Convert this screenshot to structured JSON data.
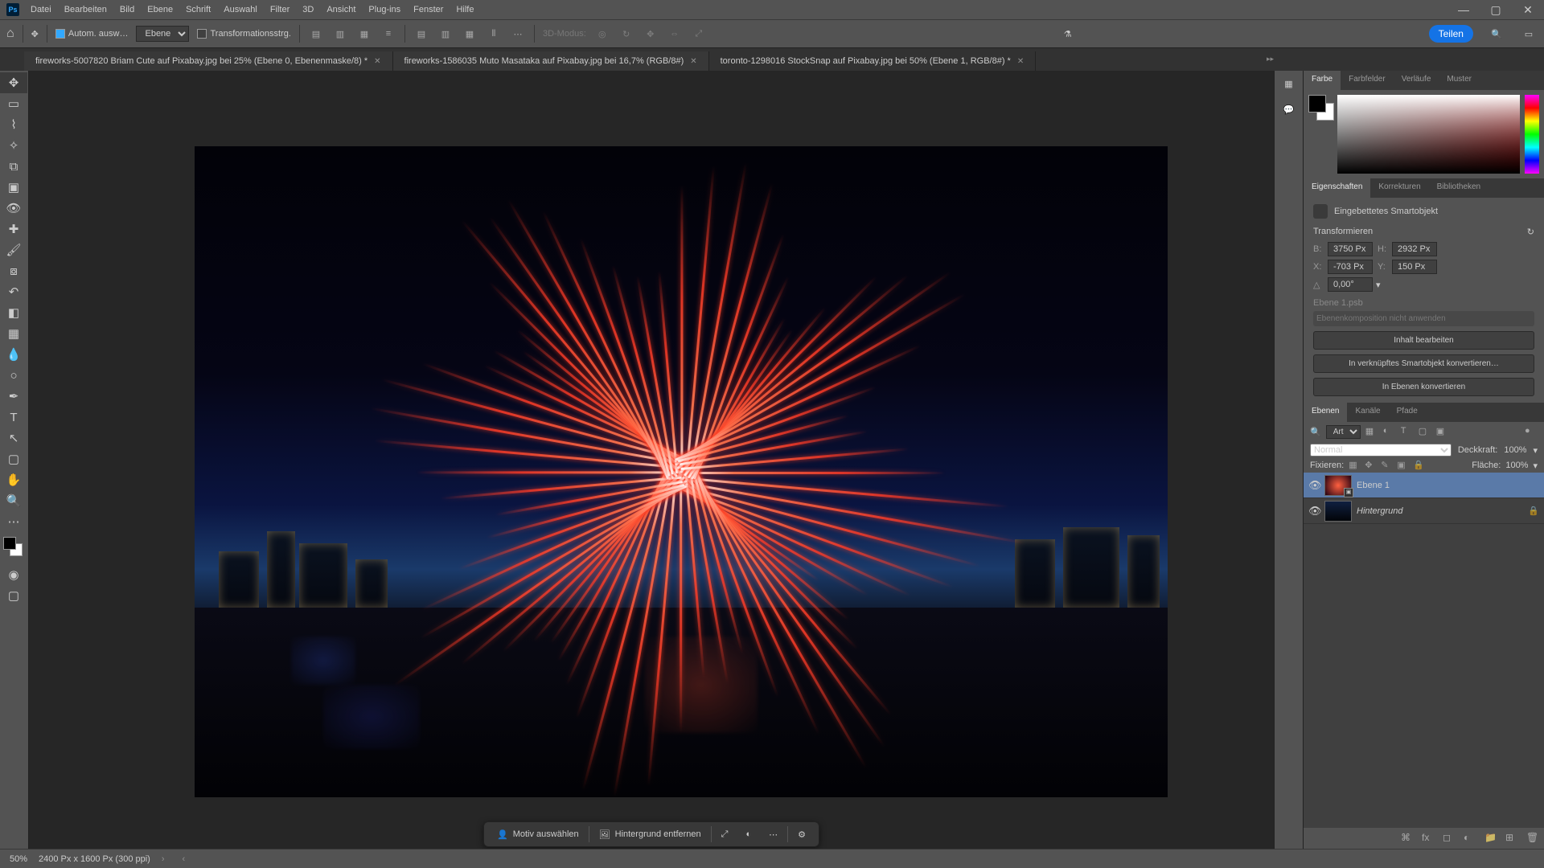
{
  "menu": {
    "items": [
      "Datei",
      "Bearbeiten",
      "Bild",
      "Ebene",
      "Schrift",
      "Auswahl",
      "Filter",
      "3D",
      "Ansicht",
      "Plug-ins",
      "Fenster",
      "Hilfe"
    ]
  },
  "optbar": {
    "auto_select": "Autom. ausw…",
    "layer_select": "Ebene",
    "transform_ctrl": "Transformationsstrg.",
    "mode3d": "3D-Modus:",
    "share": "Teilen"
  },
  "tabs": [
    {
      "label": "fireworks-5007820 Briam Cute auf Pixabay.jpg bei 25% (Ebene 0, Ebenenmaske/8) *",
      "active": false
    },
    {
      "label": "fireworks-1586035 Muto Masataka auf Pixabay.jpg bei 16,7% (RGB/8#)",
      "active": false
    },
    {
      "label": "toronto-1298016 StockSnap auf Pixabay.jpg bei 50% (Ebene 1, RGB/8#) *",
      "active": true
    }
  ],
  "tools": [
    "move",
    "rect-marquee",
    "lasso",
    "wand",
    "crop",
    "frame",
    "eyedropper",
    "healing",
    "brush",
    "stamp",
    "history-brush",
    "eraser",
    "gradient",
    "blur",
    "dodge",
    "pen",
    "type",
    "path-select",
    "rectangle",
    "hand",
    "zoom",
    "edit-toolbar"
  ],
  "contextbar": {
    "select_subject": "Motiv auswählen",
    "remove_bg": "Hintergrund entfernen"
  },
  "panels": {
    "color": {
      "tabs": [
        "Farbe",
        "Farbfelder",
        "Verläufe",
        "Muster"
      ]
    },
    "props": {
      "tabs": [
        "Eigenschaften",
        "Korrekturen",
        "Bibliotheken"
      ],
      "type": "Eingebettetes Smartobjekt",
      "transform": "Transformieren",
      "w_label": "B:",
      "w": "3750 Px",
      "h_label": "H:",
      "h": "2932 Px",
      "x_label": "X:",
      "x": "-703 Px",
      "y_label": "Y:",
      "y": "150 Px",
      "angle": "0,00°",
      "filename": "Ebene 1.psb",
      "comp_disabled": "Ebenenkomposition nicht anwenden",
      "edit_content": "Inhalt bearbeiten",
      "convert_linked": "In verknüpftes Smartobjekt konvertieren…",
      "convert_layers": "In Ebenen konvertieren"
    },
    "layers": {
      "tabs": [
        "Ebenen",
        "Kanäle",
        "Pfade"
      ],
      "kind": "Art",
      "blend": "Normal",
      "opacity_label": "Deckkraft:",
      "opacity": "100%",
      "lock_label": "Fixieren:",
      "fill_label": "Fläche:",
      "fill": "100%",
      "items": [
        {
          "name": "Ebene 1",
          "smart": true,
          "sel": true
        },
        {
          "name": "Hintergrund",
          "locked": true,
          "italic": true
        }
      ]
    }
  },
  "status": {
    "zoom": "50%",
    "docinfo": "2400 Px x 1600 Px (300 ppi)"
  }
}
